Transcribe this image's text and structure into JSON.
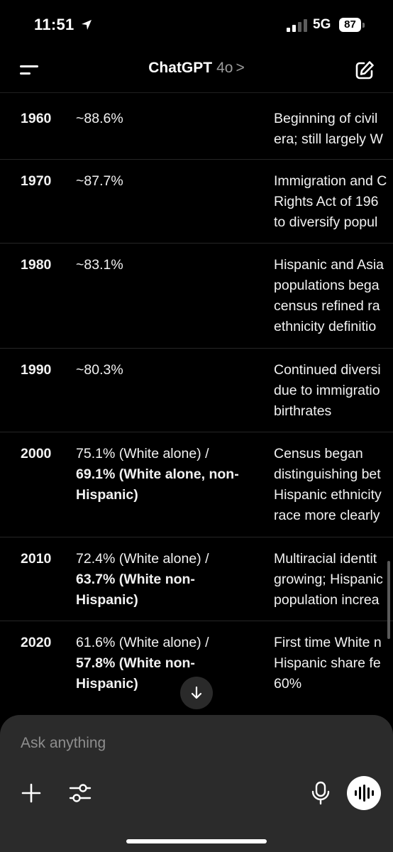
{
  "status": {
    "time": "11:51",
    "network": "5G",
    "battery": "87"
  },
  "header": {
    "title": "ChatGPT",
    "model": "4o",
    "chevron": ">"
  },
  "table": {
    "rows": [
      {
        "year": "1960",
        "share": "~88.6%",
        "share_bold": "",
        "note_lines": [
          "Beginning of civil",
          "era; still largely W"
        ]
      },
      {
        "year": "1970",
        "share": "~87.7%",
        "share_bold": "",
        "note_lines": [
          "Immigration and C",
          "Rights Act of 196",
          "to diversify popul"
        ]
      },
      {
        "year": "1980",
        "share": "~83.1%",
        "share_bold": "",
        "note_lines": [
          "Hispanic and Asia",
          "populations bega",
          "census refined ra",
          "ethnicity definitio"
        ]
      },
      {
        "year": "1990",
        "share": "~80.3%",
        "share_bold": "",
        "note_lines": [
          "Continued diversi",
          "due to immigratio",
          "birthrates"
        ]
      },
      {
        "year": "2000",
        "share": "75.1% (White alone) /",
        "share_bold": "69.1% (White alone, non-Hispanic)",
        "note_lines": [
          "Census began",
          "distinguishing bet",
          "Hispanic ethnicity",
          "race more clearly"
        ]
      },
      {
        "year": "2010",
        "share": "72.4% (White alone) /",
        "share_bold": "63.7% (White non-Hispanic)",
        "note_lines": [
          "Multiracial identit",
          "growing; Hispanic",
          "population increa"
        ]
      },
      {
        "year": "2020",
        "share": "61.6% (White alone) /",
        "share_bold": "57.8% (White non-Hispanic)",
        "note_lines": [
          "First time White n",
          "Hispanic share fe",
          "60%"
        ]
      }
    ]
  },
  "composer": {
    "placeholder": "Ask anything"
  },
  "icons": {
    "location": "location-arrow-icon",
    "menu": "menu-icon",
    "edit": "new-chat-icon",
    "scroll_down": "arrow-down-icon",
    "plus": "plus-icon",
    "tools": "sliders-icon",
    "mic": "microphone-icon",
    "voice": "voice-waveform-icon"
  }
}
